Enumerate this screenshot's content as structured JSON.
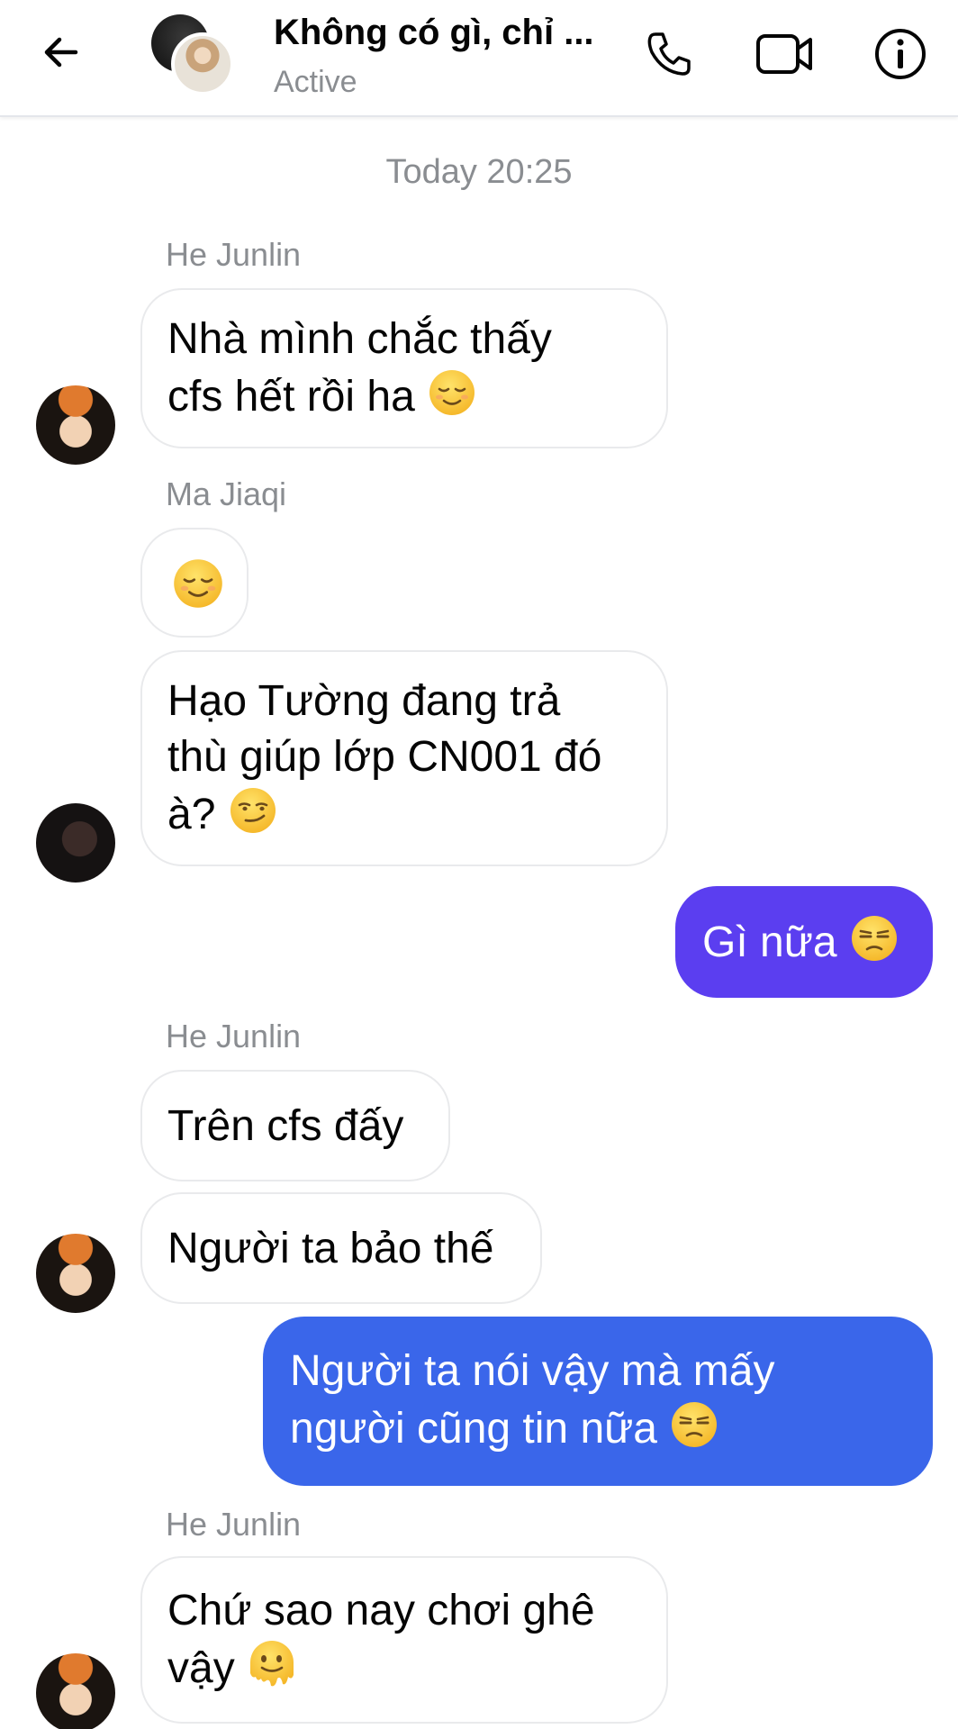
{
  "header": {
    "title": "Không có gì, chỉ ...",
    "status": "Active"
  },
  "timestamp": "Today 20:25",
  "messages": [
    {
      "sender": "He Junlin",
      "text": "Nhà mình chắc thấy\ncfs hết rồi ha",
      "emoji": "relieved-face"
    },
    {
      "sender": "Ma Jiaqi",
      "text": "",
      "emoji": "relieved-face"
    },
    {
      "sender": "",
      "text": "Hạo Tường đang trả\nthù giúp lớp CN001 đó\nà?",
      "emoji": "smirking-face"
    },
    {
      "sender": "me",
      "text": "Gì nữa",
      "emoji": "unamused-face"
    },
    {
      "sender": "He Junlin",
      "text": "Trên cfs đấy",
      "emoji": ""
    },
    {
      "sender": "",
      "text": "Người ta bảo thế",
      "emoji": ""
    },
    {
      "sender": "me",
      "text": "Người ta nói vậy mà mấy\nngười cũng tin nữa",
      "emoji": "unamused-face"
    },
    {
      "sender": "He Junlin",
      "text": "Chứ sao nay chơi ghê\nvậy",
      "emoji": "melting-face"
    }
  ],
  "colors": {
    "outgoing_purple": "#5b3ef0",
    "outgoing_blue": "#3a66ea",
    "muted_text": "#8a8d91"
  }
}
